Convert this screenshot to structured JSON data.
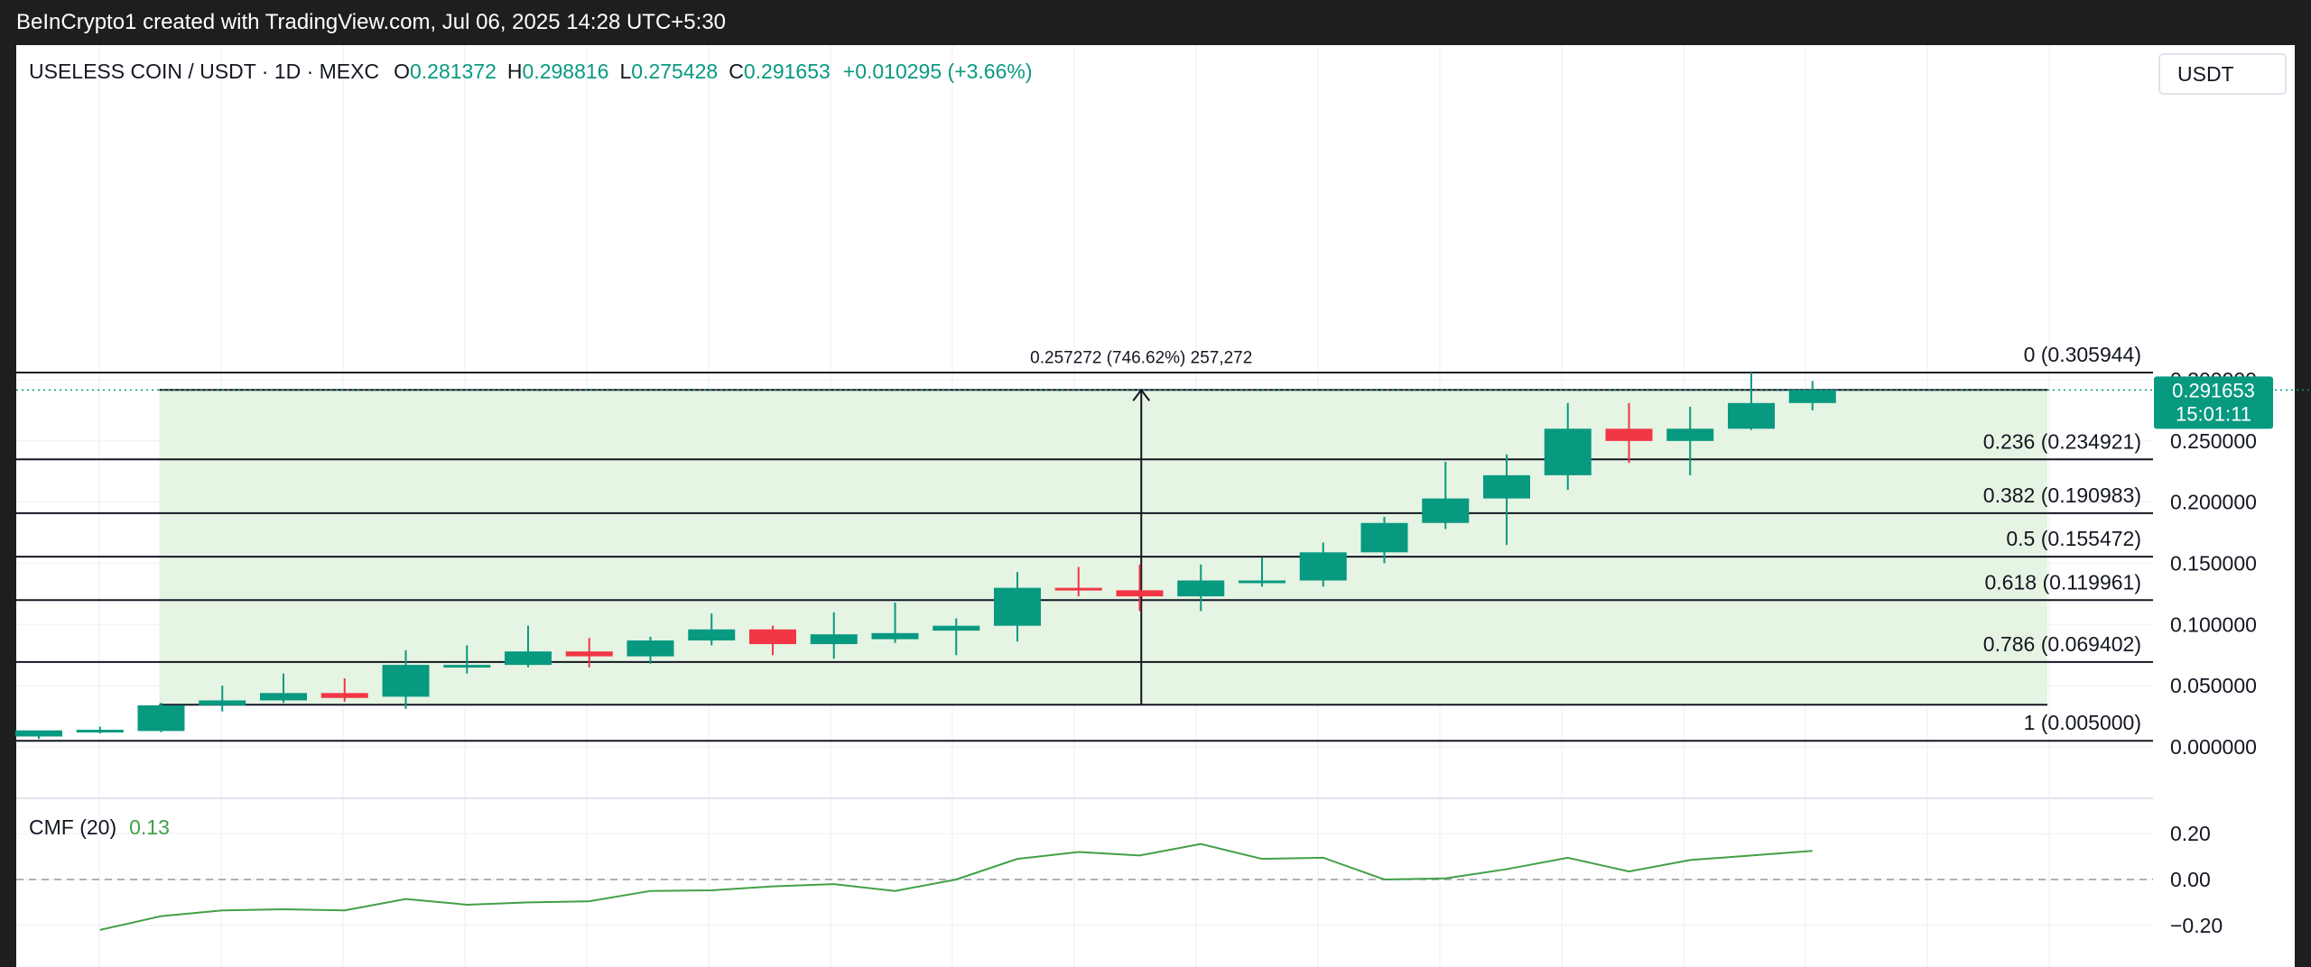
{
  "header": {
    "attribution": "BeInCrypto1 created with TradingView.com, Jul 06, 2025 14:28 UTC+5:30"
  },
  "legend": {
    "symbol": "USELESS COIN / USDT · 1D · MEXC",
    "o_label": "O",
    "o_value": "0.281372",
    "h_label": "H",
    "h_value": "0.298816",
    "l_label": "L",
    "l_value": "0.275428",
    "c_label": "C",
    "c_value": "0.291653",
    "change": "+0.010295 (+3.66%)"
  },
  "currency_button": "USDT",
  "price_tag": {
    "price": "0.291653",
    "countdown": "15:01:11"
  },
  "measure_label": "0.257272 (746.62%) 257,272",
  "colors": {
    "up": "#089981",
    "down": "#f23645",
    "fill": "#e6f4e3",
    "cmf_line": "#43a047",
    "grid": "#f0f3fa"
  },
  "chart_data": [
    {
      "type": "candlestick",
      "title": "USELESS COIN / USDT · 1D · MEXC",
      "y_axis": {
        "ticks": [
          0.0,
          0.05,
          0.1,
          0.15,
          0.2,
          0.25,
          0.3
        ],
        "tick_labels": [
          "0.000000",
          "0.050000",
          "0.100000",
          "0.150000",
          "0.200000",
          "0.250000",
          "0.300000"
        ],
        "range": [
          -0.005,
          0.315
        ]
      },
      "candles": [
        {
          "o": 0.0085,
          "h": 0.012,
          "l": 0.0065,
          "c": 0.0135
        },
        {
          "o": 0.013,
          "h": 0.0165,
          "l": 0.011,
          "c": 0.014
        },
        {
          "o": 0.013,
          "h": 0.036,
          "l": 0.012,
          "c": 0.034
        },
        {
          "o": 0.034,
          "h": 0.05,
          "l": 0.029,
          "c": 0.038
        },
        {
          "o": 0.038,
          "h": 0.06,
          "l": 0.036,
          "c": 0.044
        },
        {
          "o": 0.044,
          "h": 0.056,
          "l": 0.037,
          "c": 0.04
        },
        {
          "o": 0.041,
          "h": 0.079,
          "l": 0.031,
          "c": 0.067
        },
        {
          "o": 0.067,
          "h": 0.083,
          "l": 0.06,
          "c": 0.067
        },
        {
          "o": 0.067,
          "h": 0.099,
          "l": 0.065,
          "c": 0.078
        },
        {
          "o": 0.078,
          "h": 0.089,
          "l": 0.065,
          "c": 0.074
        },
        {
          "o": 0.074,
          "h": 0.09,
          "l": 0.068,
          "c": 0.087
        },
        {
          "o": 0.087,
          "h": 0.109,
          "l": 0.083,
          "c": 0.096
        },
        {
          "o": 0.096,
          "h": 0.099,
          "l": 0.075,
          "c": 0.084
        },
        {
          "o": 0.084,
          "h": 0.11,
          "l": 0.072,
          "c": 0.092
        },
        {
          "o": 0.088,
          "h": 0.118,
          "l": 0.085,
          "c": 0.093
        },
        {
          "o": 0.095,
          "h": 0.105,
          "l": 0.075,
          "c": 0.099
        },
        {
          "o": 0.099,
          "h": 0.143,
          "l": 0.086,
          "c": 0.13
        },
        {
          "o": 0.13,
          "h": 0.147,
          "l": 0.123,
          "c": 0.128
        },
        {
          "o": 0.128,
          "h": 0.149,
          "l": 0.111,
          "c": 0.123
        },
        {
          "o": 0.123,
          "h": 0.149,
          "l": 0.111,
          "c": 0.136
        },
        {
          "o": 0.136,
          "h": 0.155,
          "l": 0.131,
          "c": 0.136
        },
        {
          "o": 0.136,
          "h": 0.167,
          "l": 0.131,
          "c": 0.159
        },
        {
          "o": 0.159,
          "h": 0.188,
          "l": 0.15,
          "c": 0.183
        },
        {
          "o": 0.183,
          "h": 0.233,
          "l": 0.178,
          "c": 0.203
        },
        {
          "o": 0.203,
          "h": 0.239,
          "l": 0.165,
          "c": 0.222
        },
        {
          "o": 0.222,
          "h": 0.281,
          "l": 0.21,
          "c": 0.26
        },
        {
          "o": 0.26,
          "h": 0.281,
          "l": 0.232,
          "c": 0.25
        },
        {
          "o": 0.25,
          "h": 0.278,
          "l": 0.222,
          "c": 0.26
        },
        {
          "o": 0.26,
          "h": 0.306,
          "l": 0.259,
          "c": 0.281
        },
        {
          "o": 0.281,
          "h": 0.299,
          "l": 0.275,
          "c": 0.2917
        }
      ],
      "fib_levels": [
        {
          "label": "0 (0.305944)",
          "value": 0.305944
        },
        {
          "label": "0.236 (0.234921)",
          "value": 0.234921
        },
        {
          "label": "0.382 (0.190983)",
          "value": 0.190983
        },
        {
          "label": "0.5 (0.155472)",
          "value": 0.155472
        },
        {
          "label": "0.618 (0.119961)",
          "value": 0.119961
        },
        {
          "label": "0.786 (0.069402)",
          "value": 0.069402
        },
        {
          "label": "1 (0.005000)",
          "value": 0.005
        }
      ],
      "price_range_measure": {
        "from": 0.0345,
        "to": 0.2917
      },
      "last_price": 0.291653
    },
    {
      "type": "line",
      "title": "CMF (20)",
      "current_value": "0.13",
      "y_axis": {
        "ticks": [
          -0.2,
          0.0,
          0.2
        ],
        "tick_labels": [
          "−0.20",
          "0.00",
          "0.20"
        ],
        "range": [
          -0.24,
          0.21
        ]
      },
      "series": [
        {
          "values": [
            -0.22,
            -0.16,
            -0.135,
            -0.13,
            -0.135,
            -0.085,
            -0.11,
            -0.1,
            -0.095,
            -0.05,
            -0.047,
            -0.03,
            -0.02,
            -0.05,
            0.0,
            0.09,
            0.12,
            0.105,
            0.155,
            0.09,
            0.095,
            0.0,
            0.005,
            0.045,
            0.095,
            0.035,
            0.085,
            0.105,
            0.125
          ]
        }
      ]
    }
  ]
}
